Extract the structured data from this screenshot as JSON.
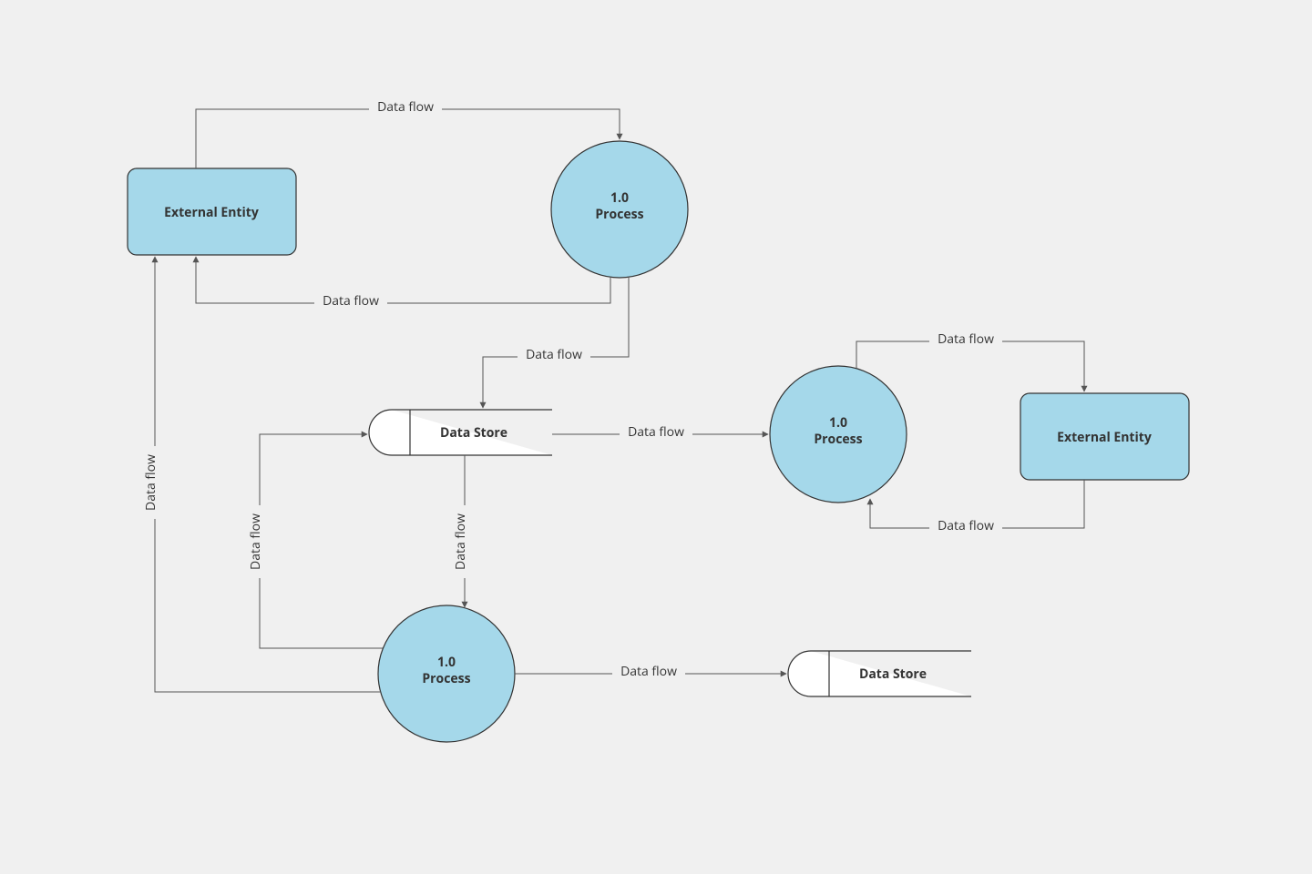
{
  "colors": {
    "node_fill": "#a5d8ea",
    "stroke": "#333333",
    "bg": "#f0f0f0"
  },
  "nodes": {
    "entity1": {
      "type": "external-entity",
      "label": "External Entity"
    },
    "process1": {
      "type": "process",
      "id": "1.0",
      "label": "Process"
    },
    "store1": {
      "type": "data-store",
      "label": "Data Store"
    },
    "process2": {
      "type": "process",
      "id": "1.0",
      "label": "Process"
    },
    "entity2": {
      "type": "external-entity",
      "label": "External Entity"
    },
    "process3": {
      "type": "process",
      "id": "1.0",
      "label": "Process"
    },
    "store2": {
      "type": "data-store",
      "label": "Data Store"
    }
  },
  "edges": {
    "e1": {
      "from": "entity1",
      "to": "process1",
      "label": "Data flow"
    },
    "e2": {
      "from": "process1",
      "to": "entity1",
      "label": "Data flow"
    },
    "e3": {
      "from": "process1",
      "to": "store1",
      "label": "Data flow"
    },
    "e4": {
      "from": "store1",
      "to": "process2",
      "label": "Data flow"
    },
    "e5": {
      "from": "process2",
      "to": "entity2",
      "label": "Data flow"
    },
    "e6": {
      "from": "entity2",
      "to": "process2",
      "label": "Data flow"
    },
    "e7": {
      "from": "store1",
      "to": "process3",
      "label": "Data flow"
    },
    "e8": {
      "from": "process3",
      "to": "store1",
      "label": "Data flow"
    },
    "e9": {
      "from": "process3",
      "to": "entity1",
      "label": "Data flow"
    },
    "e10": {
      "from": "process3",
      "to": "store2",
      "label": "Data flow"
    }
  }
}
